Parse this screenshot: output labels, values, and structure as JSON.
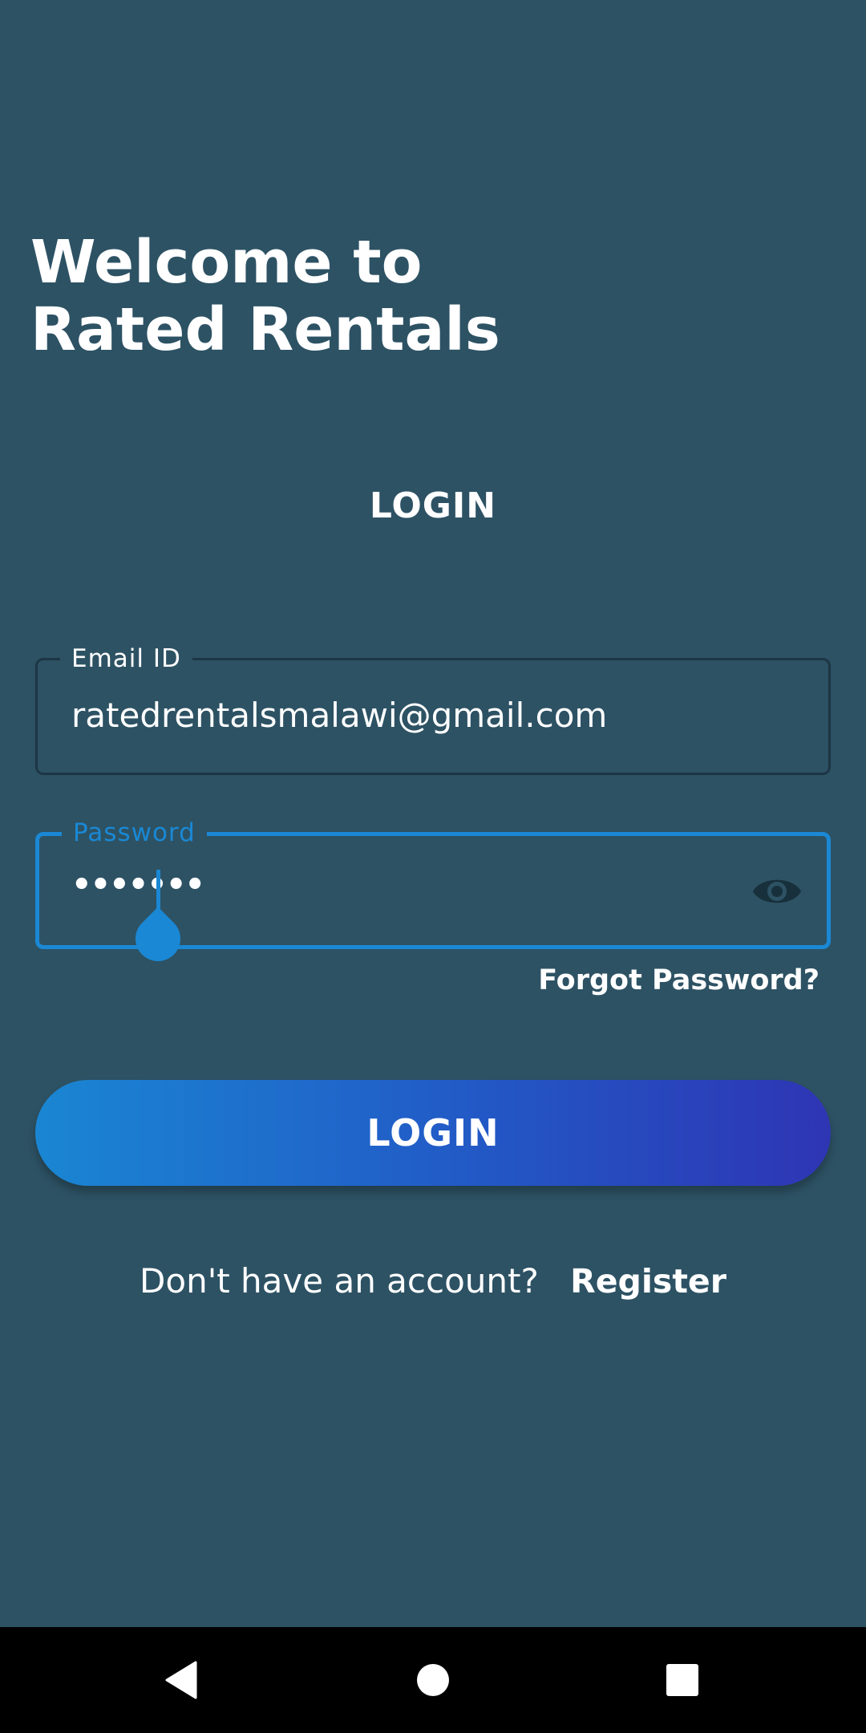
{
  "welcome": {
    "line1": "Welcome to",
    "line2": "Rated Rentals"
  },
  "login_heading": "LOGIN",
  "email_field": {
    "label": "Email ID",
    "value": "ratedrentalsmalawi@gmail.com"
  },
  "password_field": {
    "label": "Password",
    "masked_value": "•••••••",
    "toggle_icon": "eye-icon"
  },
  "forgot_password": "Forgot Password?",
  "login_button": "LOGIN",
  "register": {
    "question": "Don't have an account?",
    "link": "Register"
  },
  "navbar": {
    "back_icon": "back-triangle-icon",
    "home_icon": "home-circle-icon",
    "recents_icon": "recents-square-icon"
  },
  "colors": {
    "background": "#2d5264",
    "accent": "#1a88d4",
    "button_gradient_start": "#1a86d3",
    "button_gradient_end": "#2e35b4",
    "navbar": "#000000"
  }
}
